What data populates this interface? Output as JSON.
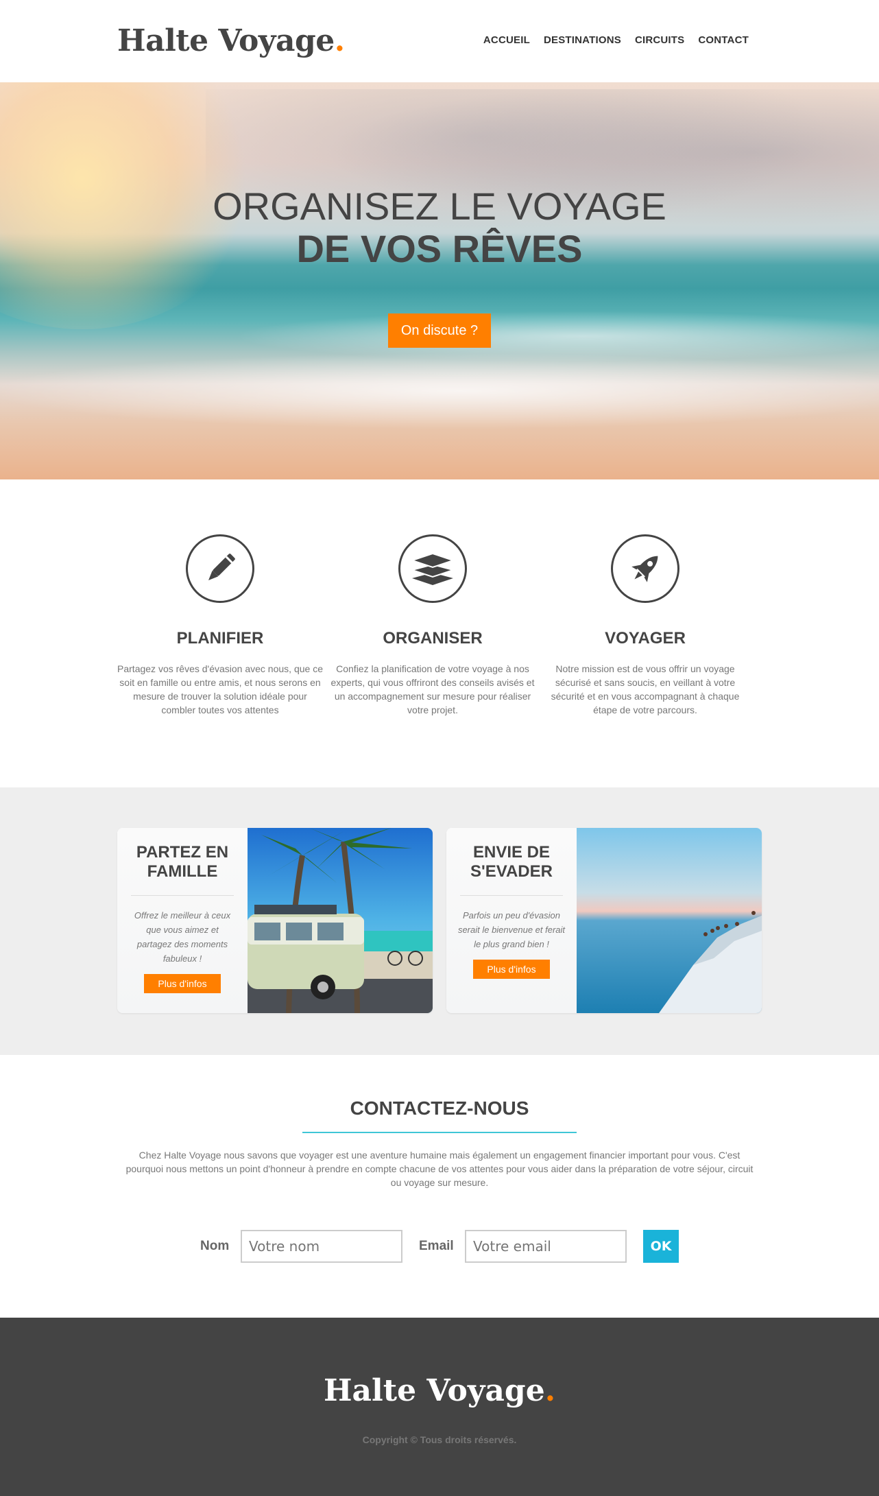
{
  "brand": {
    "name": "Halte Voyage",
    "dot": ".",
    "accent": "#ff7f00"
  },
  "nav": {
    "items": [
      "ACCUEIL",
      "DESTINATIONS",
      "CIRCUITS",
      "CONTACT"
    ]
  },
  "hero": {
    "line1": "ORGANISEZ LE VOYAGE",
    "line2": "DE VOS RÊVES",
    "cta": "On discute ?"
  },
  "features": [
    {
      "icon": "pen-icon",
      "title": "PLANIFIER",
      "text": "Partagez vos rêves d'évasion avec nous, que ce soit en famille ou entre amis, et nous serons en mesure de trouver la solution idéale pour combler toutes vos attentes"
    },
    {
      "icon": "layers-icon",
      "title": "ORGANISER",
      "text": "Confiez la planification de votre voyage à nos experts, qui vous offriront des conseils avisés et un accompagnement sur mesure pour réaliser votre projet."
    },
    {
      "icon": "rocket-icon",
      "title": "VOYAGER",
      "text": "Notre mission est de vous offrir un voyage sécurisé et sans soucis, en veillant à votre sécurité et en vous accompagnant à chaque étape de votre parcours."
    }
  ],
  "cards": [
    {
      "title_line1": "PARTEZ EN",
      "title_line2": "FAMILLE",
      "text": "Offrez le meilleur à ceux que vous aimez et partagez des moments fabuleux !",
      "button": "Plus d'infos",
      "photo": "van-under-palm-trees-photo"
    },
    {
      "title_line1": "ENVIE DE",
      "title_line2": "S'EVADER",
      "text": "Parfois un peu d'évasion serait le bienvenue et ferait le plus grand bien !",
      "button": "Plus d'infos",
      "photo": "white-cliffs-by-the-sea-photo"
    }
  ],
  "contact": {
    "title": "CONTACTEZ-NOUS",
    "text": "Chez Halte Voyage nous savons que voyager est une aventure humaine mais également un engagement financier important pour vous. C'est pourquoi nous mettons un point d'honneur à prendre en compte chacune de vos attentes pour vous aider dans la préparation de votre séjour, circuit ou voyage sur mesure.",
    "name_label": "Nom",
    "name_placeholder": "Votre nom",
    "email_label": "Email",
    "email_placeholder": "Votre email",
    "submit": "OK",
    "accent": "#1ab3d9"
  },
  "footer": {
    "copyright": "Copyright © Tous droits réservés."
  }
}
